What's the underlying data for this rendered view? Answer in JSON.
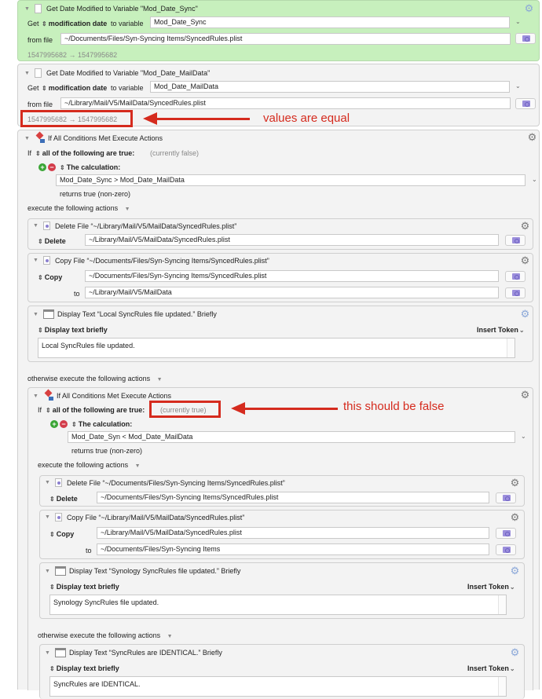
{
  "action1": {
    "title": "Get Date Modified to Variable \"Mod_Date_Sync\"",
    "get_label": "Get",
    "attribute": "modification date",
    "to_variable_label": "to variable",
    "variable": "Mod_Date_Sync",
    "from_file_label": "from file",
    "file_path": "~/Documents/Files/Syn-Syncing Items/SyncedRules.plist",
    "result": "1547995682 → 1547995682"
  },
  "action2": {
    "title": "Get Date Modified to Variable \"Mod_Date_MailData\"",
    "get_label": "Get",
    "attribute": "modification date",
    "to_variable_label": "to variable",
    "variable": "Mod_Date_MailData",
    "from_file_label": "from file",
    "file_path": "~/Library/Mail/V5/MailData/SyncedRules.plist",
    "result": "1547995682 → 1547995682"
  },
  "annotations": {
    "values_equal": "values are equal",
    "should_be_false": "this should be false"
  },
  "if1": {
    "title": "If All Conditions Met Execute Actions",
    "if_label": "If",
    "condition_mode": "all of the following are true:",
    "status": "(currently false)",
    "condition_type": "The calculation:",
    "calculation": "Mod_Date_Sync > Mod_Date_MailData",
    "returns": "returns true (non-zero)",
    "execute_label": "execute the following actions",
    "delete": {
      "title": "Delete File “~/Library/Mail/V5/MailData/SyncedRules.plist”",
      "label": "Delete",
      "path": "~/Library/Mail/V5/MailData/SyncedRules.plist"
    },
    "copy": {
      "title": "Copy File “~/Documents/Files/Syn-Syncing Items/SyncedRules.plist”",
      "label": "Copy",
      "path": "~/Documents/Files/Syn-Syncing Items/SyncedRules.plist",
      "to_label": "to",
      "to_path": "~/Library/Mail/V5/MailData"
    },
    "display": {
      "title": "Display Text “Local SyncRules file updated.” Briefly",
      "mode": "Display text briefly",
      "insert_token": "Insert Token",
      "text": "Local SyncRules file updated."
    },
    "otherwise_label": "otherwise execute the following actions"
  },
  "if2": {
    "title": "If All Conditions Met Execute Actions",
    "if_label": "If",
    "condition_mode": "all of the following are true:",
    "status": "(currently true)",
    "condition_type": "The calculation:",
    "calculation": "Mod_Date_Syn < Mod_Date_MailData",
    "returns": "returns true (non-zero)",
    "execute_label": "execute the following actions",
    "delete": {
      "title": "Delete File “~/Documents/Files/Syn-Syncing Items/SyncedRules.plist”",
      "label": "Delete",
      "path": "~/Documents/Files/Syn-Syncing Items/SyncedRules.plist"
    },
    "copy": {
      "title": "Copy File “~/Library/Mail/V5/MailData/SyncedRules.plist”",
      "label": "Copy",
      "path": "~/Library/Mail/V5/MailData/SyncedRules.plist",
      "to_label": "to",
      "to_path": "~/Documents/Files/Syn-Syncing Items"
    },
    "display": {
      "title": "Display Text “Synology SyncRules file updated.” Briefly",
      "mode": "Display text briefly",
      "insert_token": "Insert Token",
      "text": "Synology SyncRules file updated."
    },
    "otherwise_label": "otherwise execute the following actions",
    "else_display": {
      "title": "Display Text “SyncRules are IDENTICAL.” Briefly",
      "mode": "Display text briefly",
      "insert_token": "Insert Token",
      "text": "SyncRules are IDENTICAL."
    }
  },
  "icons": {
    "gear": "⚙",
    "disclosure": "▼",
    "updown": "↕",
    "chevron": "⌄",
    "plus": "+",
    "minus": "−"
  }
}
